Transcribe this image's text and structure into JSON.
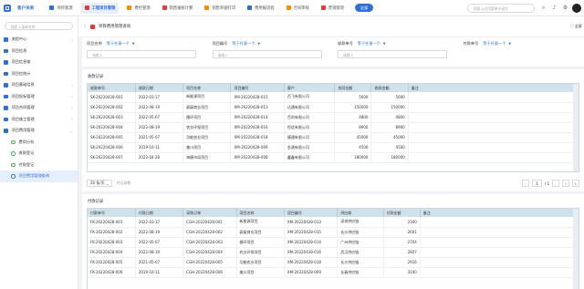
{
  "topbar": {
    "system_name": "客户关系",
    "tabs": [
      {
        "label": "项目管理",
        "color": "#2f6fd6",
        "active": false
      },
      {
        "label": "工程项目管理",
        "color": "#e53935",
        "active": true
      },
      {
        "label": "费控管理",
        "color": "#fb8c00",
        "active": false
      },
      {
        "label": "销售报统计算",
        "color": "#e53935",
        "active": false
      },
      {
        "label": "销售单据打印",
        "color": "#fb8c00",
        "active": false
      },
      {
        "label": "费用报流程",
        "color": "#2f6fd6",
        "active": false
      },
      {
        "label": "合同审核",
        "color": "#fb8c00",
        "active": false
      },
      {
        "label": "营销管理",
        "color": "#e53935",
        "active": false
      }
    ],
    "all_label": "全部",
    "search_placeholder": "搜索入应用菜单关键字"
  },
  "sidebar": {
    "search_placeholder": "搜索入菜单名称",
    "items": [
      {
        "label": "流程中心",
        "type": "group",
        "arrow": "‹"
      },
      {
        "label": "项目信息",
        "type": "item"
      },
      {
        "label": "项目信息查",
        "type": "item"
      },
      {
        "label": "项目信统计",
        "type": "item"
      },
      {
        "label": "项目基础信息",
        "type": "group",
        "arrow": "›"
      },
      {
        "label": "项目投标管理",
        "type": "group",
        "arrow": "›"
      },
      {
        "label": "项目合同管理",
        "type": "group",
        "arrow": "›"
      },
      {
        "label": "项目施工管理",
        "type": "group",
        "arrow": "›"
      },
      {
        "label": "项目费用管理",
        "type": "group",
        "arrow": "⌄"
      },
      {
        "label": "费用分析",
        "type": "sub"
      },
      {
        "label": "收款登记",
        "type": "sub"
      },
      {
        "label": "付款登记",
        "type": "sub"
      },
      {
        "label": "项目费用管理查询",
        "type": "sub",
        "active": true
      }
    ]
  },
  "breadcrumb": {
    "title": "项目费用管理查询",
    "fullscreen": "全屏"
  },
  "filters": [
    {
      "label": "项目名称",
      "select": "等于任意一个",
      "placeholder": "请输入"
    },
    {
      "label": "项目编号",
      "select": "等于任意一个",
      "placeholder": "请输入"
    },
    {
      "label": "收款单号",
      "select": "等于任意一个",
      "placeholder": "请输入"
    },
    {
      "label": "付款单号",
      "select": "等于任意一个",
      "placeholder": ""
    }
  ],
  "receipts": {
    "title": "收款记录",
    "columns": [
      "收款单号",
      "收款日期",
      "项目名称",
      "项目编号",
      "客户",
      "合同金额",
      "收款金额",
      "备注"
    ],
    "rows": [
      [
        "SK-20220428-001",
        "2022-03-17",
        "新能源项目",
        "XM-20220428-015",
        "百飞有限公司",
        "5600",
        "5600",
        ""
      ],
      [
        "SK-20220428-002",
        "2022-08-19",
        "豪厦商业项目",
        "XM-20220428-013",
        "达通有限公司",
        "150000",
        "150000",
        ""
      ],
      [
        "SK-20220428-003",
        "2022-05-07",
        "循环项目",
        "XM-20220428-014",
        "百尚有限公司",
        "4800",
        "4800",
        ""
      ],
      [
        "SK-20220428-004",
        "2022-08-19",
        "农业环保项目",
        "XM-20220428-016",
        "恒信有限公司",
        "8900",
        "8900",
        ""
      ],
      [
        "SK-20220428-005",
        "2021-05-07",
        "功能农业项目",
        "XM-20220428-018",
        "捷通有限公司",
        "45000",
        "45000",
        ""
      ],
      [
        "SK-20220428-006",
        "2019-10-11",
        "美川项目",
        "XM-20220428-009",
        "金通有限公司",
        "4500",
        "4500",
        ""
      ],
      [
        "SK-20220428-007",
        "2022-04-28",
        "海捷市局项目",
        "XM-20220428-008",
        "鑫鑫有限公司",
        "180000",
        "180000",
        ""
      ]
    ],
    "page_size": "20 条/页",
    "total": "共记录数",
    "page": "1",
    "pages": "/ 1"
  },
  "payments": {
    "title": "付款记录",
    "columns": [
      "付款单号",
      "付款日期",
      "采购订单",
      "项目名称",
      "项目编号",
      "供应商",
      "付款金额",
      "备注"
    ],
    "rows": [
      [
        "FK-20220428-001",
        "2022-03-17",
        "CGH-20220428-001",
        "新能源项目",
        "XM-20220428-013",
        "深圳供应链",
        "2300",
        ""
      ],
      [
        "FK-20220428-002",
        "2022-08-19",
        "CGH-20220428-002",
        "豪厦商业项目",
        "XM-20220428-015",
        "长沙供应链",
        "2601",
        ""
      ],
      [
        "FK-20220428-003",
        "2022-05-07",
        "CGH-20220428-003",
        "循环项目",
        "XM-20220428-014",
        "广州供应链",
        "2704",
        ""
      ],
      [
        "FK-20220428-004",
        "2022-08-19",
        "CGH-20220428-004",
        "农业环保项目",
        "XM-20220428-016",
        "武汉供应链",
        "2807",
        ""
      ],
      [
        "FK-20220428-005",
        "2021-05-07",
        "CGH-20220428-005",
        "功能农业项目",
        "XM-20220428-018",
        "长沙供应链",
        "2916",
        ""
      ],
      [
        "FK-20220428-006",
        "2019-10-11",
        "CGH-20220428-006",
        "美川项目",
        "XM-20220428-009",
        "长春供应链",
        "3100",
        ""
      ]
    ]
  }
}
